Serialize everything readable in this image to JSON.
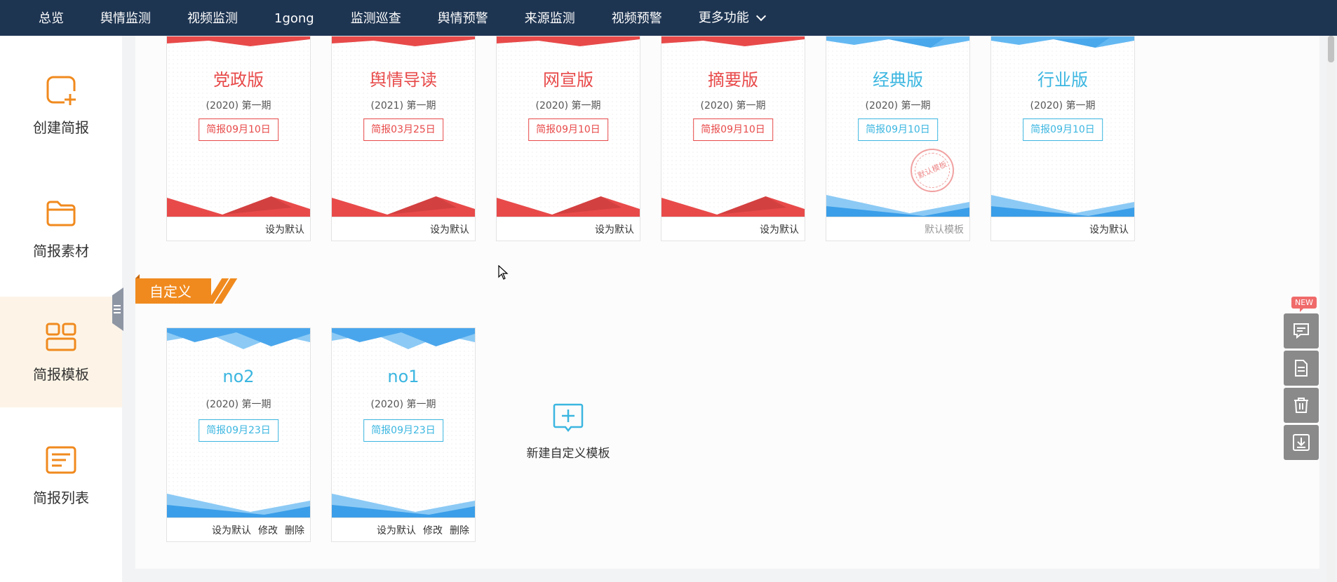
{
  "nav": {
    "items": [
      "总览",
      "舆情监测",
      "视频监测",
      "1gong",
      "监测巡查",
      "舆情预警",
      "来源监测",
      "视频预警"
    ],
    "more_label": "更多功能"
  },
  "sidebar": {
    "items": [
      {
        "label": "创建简报",
        "icon": "document-add-icon"
      },
      {
        "label": "简报素材",
        "icon": "folder-icon"
      },
      {
        "label": "简报模板",
        "icon": "grid-icon",
        "active": true
      },
      {
        "label": "简报列表",
        "icon": "list-icon"
      }
    ]
  },
  "templates": [
    {
      "title": "党政版",
      "issue": "(2020) 第一期",
      "badge": "简报09月10日",
      "footer": "设为默认",
      "theme": "red"
    },
    {
      "title": "舆情导读",
      "issue": "(2021) 第一期",
      "badge": "简报03月25日",
      "footer": "设为默认",
      "theme": "red"
    },
    {
      "title": "网宣版",
      "issue": "(2020) 第一期",
      "badge": "简报09月10日",
      "footer": "设为默认",
      "theme": "red"
    },
    {
      "title": "摘要版",
      "issue": "(2020) 第一期",
      "badge": "简报09月10日",
      "footer": "设为默认",
      "theme": "red"
    },
    {
      "title": "经典版",
      "issue": "(2020) 第一期",
      "badge": "简报09月10日",
      "footer": "默认模板",
      "stamp": "默认模板",
      "theme": "blue"
    },
    {
      "title": "行业版",
      "issue": "(2020) 第一期",
      "badge": "简报09月10日",
      "footer": "设为默认",
      "theme": "blue"
    }
  ],
  "custom_section": {
    "label": "自定义",
    "templates": [
      {
        "title": "no2",
        "issue": "(2020) 第一期",
        "badge": "简报09月23日"
      },
      {
        "title": "no1",
        "issue": "(2020) 第一期",
        "badge": "简报09月23日"
      }
    ],
    "actions": {
      "set_default": "设为默认",
      "edit": "修改",
      "delete": "删除"
    },
    "new_template_label": "新建自定义模板"
  },
  "float_toolbar": {
    "new_badge": "NEW",
    "buttons": [
      "chat-icon",
      "document-icon",
      "trash-icon",
      "download-icon"
    ]
  },
  "colors": {
    "nav_bg": "#1e3552",
    "accent_orange": "#f08a1e",
    "red": "#e84a4a",
    "blue": "#3bb6e0"
  }
}
